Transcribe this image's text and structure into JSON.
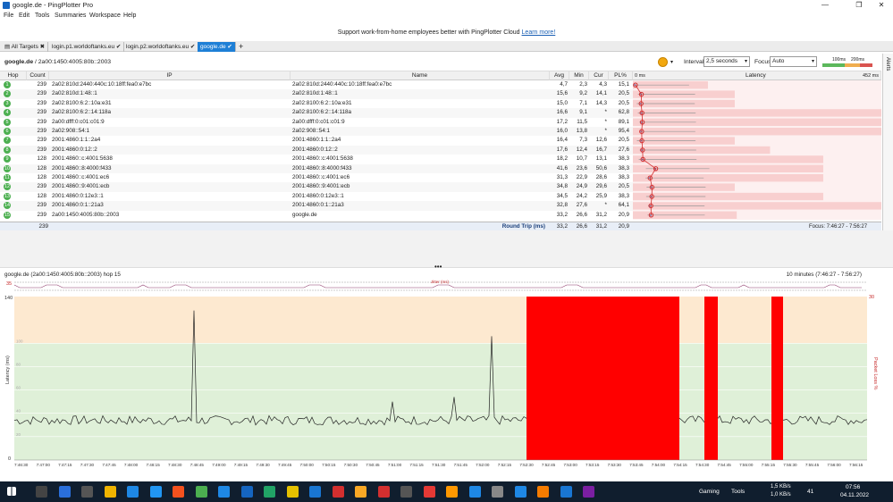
{
  "app": {
    "title": "google.de - PingPlotter Pro"
  },
  "menu": [
    "File",
    "Edit",
    "Tools",
    "Summaries",
    "Workspace",
    "Help"
  ],
  "banner": {
    "text": "Support work-from-home employees better with PingPlotter Cloud ",
    "link": "Learn more!"
  },
  "tabs": [
    {
      "label": "All Targets",
      "mark": "✖"
    },
    {
      "label": "login.p1.worldoftanks.eu",
      "mark": "✔"
    },
    {
      "label": "login.p2.worldoftanks.eu",
      "mark": "✔"
    },
    {
      "label": "google.de",
      "mark": "✔"
    },
    {
      "label": "+",
      "mark": ""
    }
  ],
  "toolbar": {
    "breadcrumb_host": "google.de",
    "breadcrumb_rest": " / 2a00:1450:4005:80b::2003",
    "interval_label": "Interval",
    "interval_value": "2,5 seconds",
    "focus_label": "Focus",
    "focus_value": "Auto",
    "scale_100": "100ms",
    "scale_200": "200ms"
  },
  "alerts_label": "Alerts",
  "columns": {
    "hop": "Hop",
    "count": "Count",
    "ip": "IP",
    "name": "Name",
    "avg": "Avg",
    "min": "Min",
    "cur": "Cur",
    "pl": "PL%",
    "zero": "0 ms",
    "latency": "Latency",
    "max": "452 ms"
  },
  "hops": [
    {
      "hop": "1",
      "count": "239",
      "ip": "2a02:810d:2440:440c:10:18ff:fea0:e7bc",
      "name": "2a02:810d:2440:440c:10:18ff:fea0:e7bc",
      "avg": "4,7",
      "min": "2,3",
      "cur": "4,3",
      "pl": "15,1",
      "color": "#4caf50"
    },
    {
      "hop": "2",
      "count": "239",
      "ip": "2a02:810d:1:48::1",
      "name": "2a02:810d:1:48::1",
      "avg": "15,6",
      "min": "9,2",
      "cur": "14,1",
      "pl": "20,5",
      "color": "#4caf50"
    },
    {
      "hop": "3",
      "count": "239",
      "ip": "2a02:8100:6:2::10a:e31",
      "name": "2a02:8100:6:2::10a:e31",
      "avg": "15,0",
      "min": "7,1",
      "cur": "14,3",
      "pl": "20,5",
      "color": "#4caf50"
    },
    {
      "hop": "4",
      "count": "239",
      "ip": "2a02:8100:6:2::14:118a",
      "name": "2a02:8100:6:2::14:118a",
      "avg": "16,6",
      "min": "9,1",
      "cur": "*",
      "pl": "62,8",
      "color": "#4caf50"
    },
    {
      "hop": "5",
      "count": "239",
      "ip": "2a00:dfff:0:c01:c01:9",
      "name": "2a00:dfff:0:c01:c01:9",
      "avg": "17,2",
      "min": "11,5",
      "cur": "*",
      "pl": "89,1",
      "color": "#4caf50"
    },
    {
      "hop": "6",
      "count": "239",
      "ip": "2a02:908::54:1",
      "name": "2a02:908::54:1",
      "avg": "16,0",
      "min": "13,8",
      "cur": "*",
      "pl": "95,4",
      "color": "#4caf50"
    },
    {
      "hop": "7",
      "count": "239",
      "ip": "2001:4860:1:1::2a4",
      "name": "2001:4860:1:1::2a4",
      "avg": "16,4",
      "min": "7,3",
      "cur": "12,6",
      "pl": "20,5",
      "color": "#4caf50"
    },
    {
      "hop": "8",
      "count": "239",
      "ip": "2001:4860:0:12::2",
      "name": "2001:4860:0:12::2",
      "avg": "17,6",
      "min": "12,4",
      "cur": "16,7",
      "pl": "27,6",
      "color": "#4caf50"
    },
    {
      "hop": "9",
      "count": "128",
      "ip": "2001:4860::c:4001:5638",
      "name": "2001:4860::c:4001:5638",
      "avg": "18,2",
      "min": "10,7",
      "cur": "13,1",
      "pl": "38,3",
      "color": "#4caf50"
    },
    {
      "hop": "10",
      "count": "128",
      "ip": "2001:4860::8:4000:f433",
      "name": "2001:4860::8:4000:f433",
      "avg": "41,6",
      "min": "23,6",
      "cur": "50,6",
      "pl": "38,3",
      "color": "#4caf50"
    },
    {
      "hop": "11",
      "count": "128",
      "ip": "2001:4860::c:4001:ec6",
      "name": "2001:4860::c:4001:ec6",
      "avg": "31,3",
      "min": "22,9",
      "cur": "28,6",
      "pl": "38,3",
      "color": "#4caf50"
    },
    {
      "hop": "12",
      "count": "239",
      "ip": "2001:4860::9:4001:ecb",
      "name": "2001:4860::9:4001:ecb",
      "avg": "34,8",
      "min": "24,9",
      "cur": "29,6",
      "pl": "20,5",
      "color": "#4caf50"
    },
    {
      "hop": "13",
      "count": "128",
      "ip": "2001:4860:0:12e3::1",
      "name": "2001:4860:0:12e3::1",
      "avg": "34,5",
      "min": "24,2",
      "cur": "25,9",
      "pl": "38,3",
      "color": "#4caf50"
    },
    {
      "hop": "14",
      "count": "239",
      "ip": "2001:4860:0:1::21a3",
      "name": "2001:4860:0:1::21a3",
      "avg": "32,8",
      "min": "27,6",
      "cur": "*",
      "pl": "64,1",
      "color": "#4caf50"
    },
    {
      "hop": "15",
      "count": "239",
      "ip": "2a00:1450:4005:80b::2003",
      "name": "google.de",
      "avg": "33,2",
      "min": "26,6",
      "cur": "31,2",
      "pl": "20,9",
      "color": "#4caf50"
    }
  ],
  "summary": {
    "count": "239",
    "label": "Round Trip (ms)",
    "avg": "33,2",
    "min": "26,6",
    "cur": "31,2",
    "pl": "20,9",
    "focus": "Focus: 7:46:27 - 7:56:27"
  },
  "timeline": {
    "title": "google.de (2a00:1450:4005:80b::2003) hop 15",
    "range": "10 minutes (7:46:27 - 7:56:27)",
    "jitter_label": "Jitter (ms)",
    "jitter_max": "35",
    "loss_max": "30",
    "y_max": "140",
    "y_min": "0",
    "y_ticks": [
      "100",
      "80",
      "60",
      "40",
      "20"
    ],
    "ylabel": "Latency (ms)",
    "y2label": "Packet Loss %",
    "x_labels": [
      "7:46:30",
      "7:47:00",
      "7:47:15",
      "7:47:30",
      "7:47:45",
      "7:48:00",
      "7:48:15",
      "7:48:30",
      "7:48:45",
      "7:49:00",
      "7:49:15",
      "7:49:30",
      "7:49:45",
      "7:50:00",
      "7:50:15",
      "7:50:30",
      "7:50:45",
      "7:51:00",
      "7:51:15",
      "7:51:30",
      "7:51:45",
      "7:52:00",
      "7:52:15",
      "7:52:30",
      "7:52:45",
      "7:53:00",
      "7:53:15",
      "7:53:30",
      "7:53:45",
      "7:54:00",
      "7:54:15",
      "7:54:30",
      "7:54:45",
      "7:55:00",
      "7:55:15",
      "7:55:30",
      "7:55:45",
      "7:56:00",
      "7:56:15"
    ],
    "outage_colors": {
      "loss": "#ff0000",
      "good": "#dff0d8",
      "warn": "#fde9d0"
    }
  },
  "taskbar": {
    "gaming": "Gaming",
    "tools": "Tools",
    "net_up": "1,5 KB/s",
    "net_down": "1,0 KB/s",
    "volume": "41",
    "time": "07:56",
    "date": "04.11.2022"
  }
}
